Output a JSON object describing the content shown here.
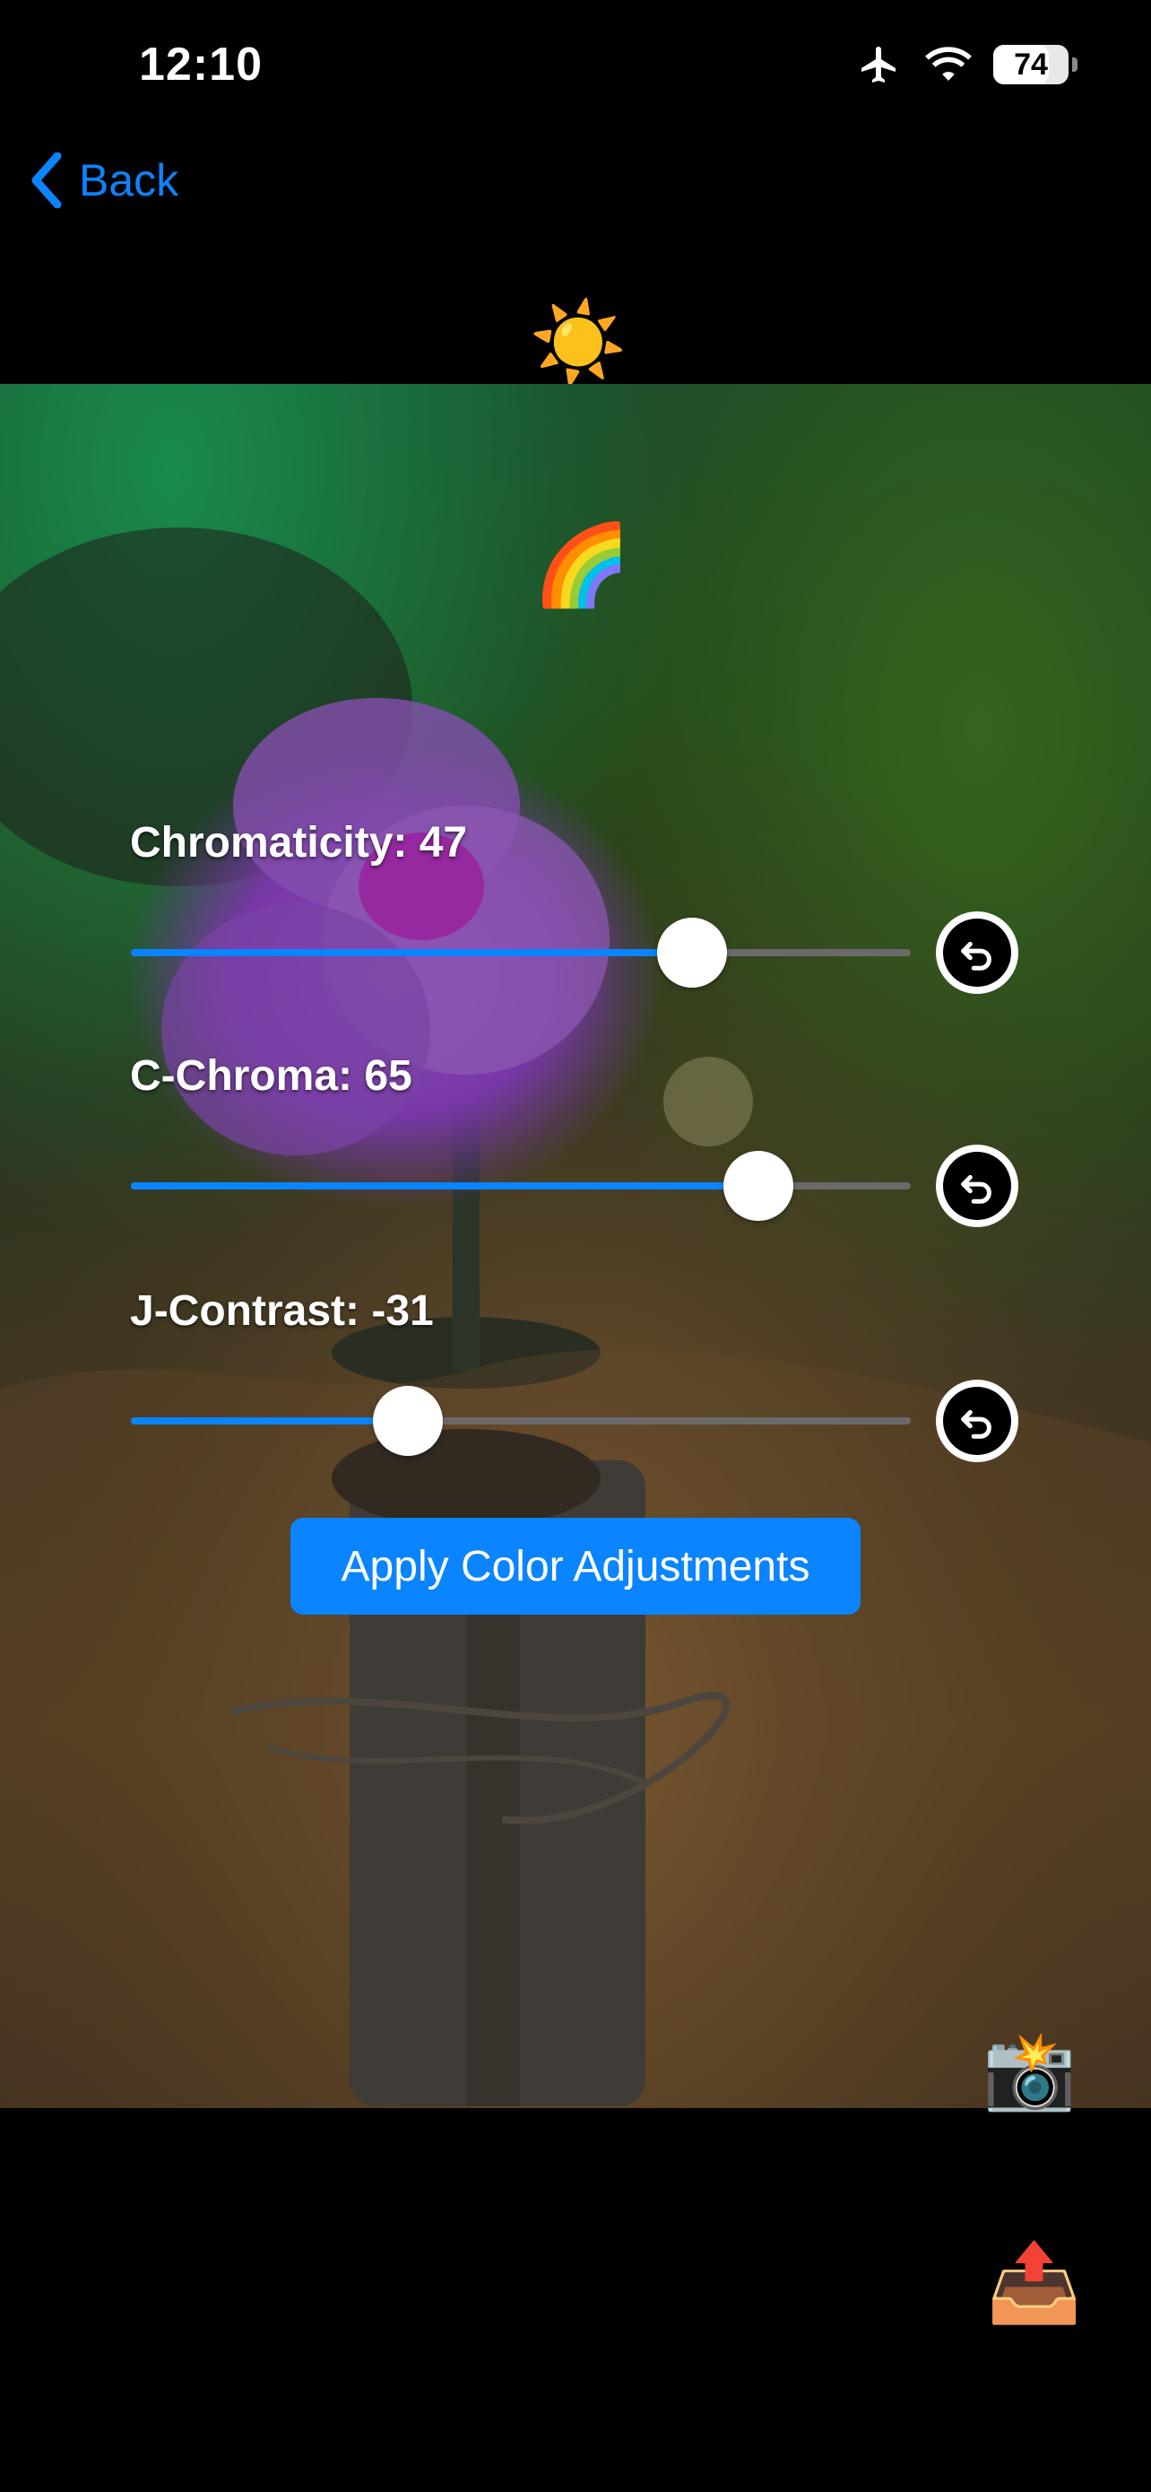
{
  "status_bar": {
    "time": "12:10",
    "battery": "74",
    "battery_level": 0.74
  },
  "nav": {
    "back_label": "Back"
  },
  "toolbar": {
    "sun_icon": "☀️",
    "rainbow_icon": "🌈"
  },
  "sliders": [
    {
      "label": "Chromaticity: 47",
      "fraction": 0.72
    },
    {
      "label": "C-Chroma: 65",
      "fraction": 0.805
    },
    {
      "label": "J-Contrast: -31",
      "fraction": 0.355
    }
  ],
  "apply_label": "Apply Color Adjustments",
  "icons": {
    "camera": "📸",
    "share": "📤"
  },
  "colors": {
    "accent": "#0a84ff",
    "background": "#000000"
  }
}
